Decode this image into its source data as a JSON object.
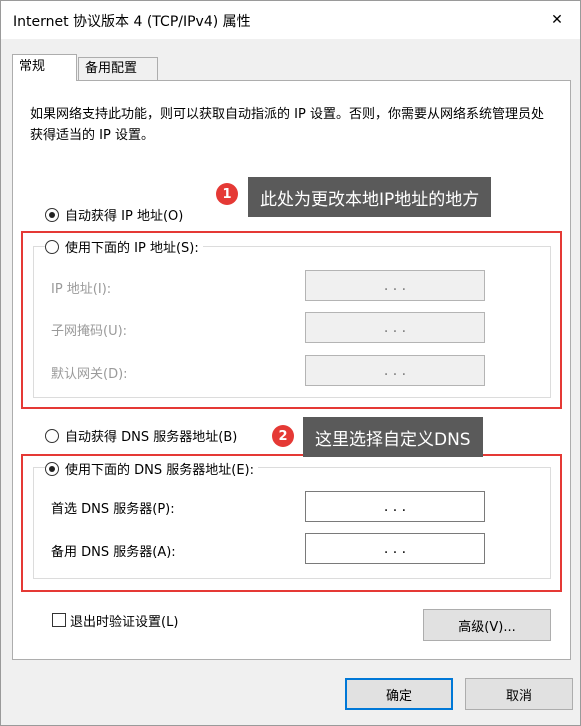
{
  "window": {
    "title": "Internet 协议版本 4 (TCP/IPv4) 属性",
    "close_glyph": "✕"
  },
  "tabs": [
    {
      "label": "常规"
    },
    {
      "label": "备用配置"
    }
  ],
  "description": "如果网络支持此功能，则可以获取自动指派的 IP 设置。否则，你需要从网络系统管理员处获得适当的 IP 设置。",
  "ip_section": {
    "auto_label": "自动获得 IP 地址(O)",
    "manual_label": "使用下面的 IP 地址(S):",
    "fields": [
      {
        "label": "IP 地址(I):",
        "value": ". . ."
      },
      {
        "label": "子网掩码(U):",
        "value": ". . ."
      },
      {
        "label": "默认网关(D):",
        "value": ". . ."
      }
    ]
  },
  "dns_section": {
    "auto_label": "自动获得 DNS 服务器地址(B)",
    "manual_label": "使用下面的 DNS 服务器地址(E):",
    "fields": [
      {
        "label": "首选 DNS 服务器(P):",
        "value": ". . ."
      },
      {
        "label": "备用 DNS 服务器(A):",
        "value": ". . ."
      }
    ]
  },
  "annotations": [
    {
      "number": "1",
      "text": "此处为更改本地IP地址的地方"
    },
    {
      "number": "2",
      "text": "这里选择自定义DNS"
    }
  ],
  "validate_checkbox": {
    "label": "退出时验证设置(L)",
    "checked": false
  },
  "buttons": {
    "advanced": "高级(V)...",
    "ok": "确定",
    "cancel": "取消"
  },
  "colors": {
    "annotation_red": "#e53935",
    "callout_bg": "#5a5a5a",
    "default_button_border": "#0078d7"
  }
}
